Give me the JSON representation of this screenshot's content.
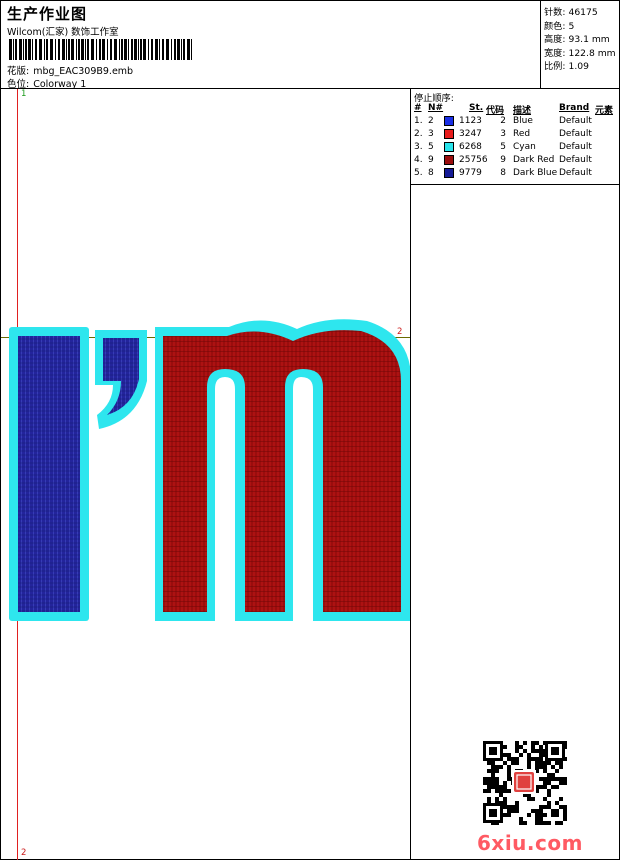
{
  "header": {
    "title": "生产作业图",
    "studio": "Wilcom(汇家) 数饰工作室",
    "design_label": "花版:",
    "design_file": "mbg_EAC309B9.emb",
    "colorway_label": "色位:",
    "colorway": "Colorway 1"
  },
  "stats": [
    {
      "label": "针数:",
      "value": "46175"
    },
    {
      "label": "颜色:",
      "value": "5"
    },
    {
      "label": "高度:",
      "value": "93.1 mm"
    },
    {
      "label": "宽度:",
      "value": "122.8 mm"
    },
    {
      "label": "比例:",
      "value": "1.09"
    }
  ],
  "stop_sequence": {
    "title": "停止顺序:",
    "headers": {
      "num": "#",
      "n": "N#",
      "st": "St.",
      "code": "代码",
      "desc": "描述",
      "brand": "Brand",
      "element": "元素"
    },
    "rows": [
      {
        "num": "1.",
        "n": "2",
        "color": "#1a2fe6",
        "st": "1123",
        "code": "2",
        "desc": "Blue",
        "brand": "Default"
      },
      {
        "num": "2.",
        "n": "3",
        "color": "#e81c1c",
        "st": "3247",
        "code": "3",
        "desc": "Red",
        "brand": "Default"
      },
      {
        "num": "3.",
        "n": "5",
        "color": "#28e4ec",
        "st": "6268",
        "code": "5",
        "desc": "Cyan",
        "brand": "Default"
      },
      {
        "num": "4.",
        "n": "9",
        "color": "#9b0d0d",
        "st": "25756",
        "code": "9",
        "desc": "Dark Red",
        "brand": "Default"
      },
      {
        "num": "5.",
        "n": "8",
        "color": "#141a96",
        "st": "9779",
        "code": "8",
        "desc": "Dark Blue",
        "brand": "Default"
      }
    ]
  },
  "markers": {
    "top_green": "1",
    "right_red": "2",
    "bottom_red": "2"
  },
  "watermark": "6xiu.com",
  "colors": {
    "cyan_border": "#2ee6ee",
    "dark_red": "#9b0d0d",
    "dark_blue": "#23249c",
    "guide_red": "#e02020"
  }
}
